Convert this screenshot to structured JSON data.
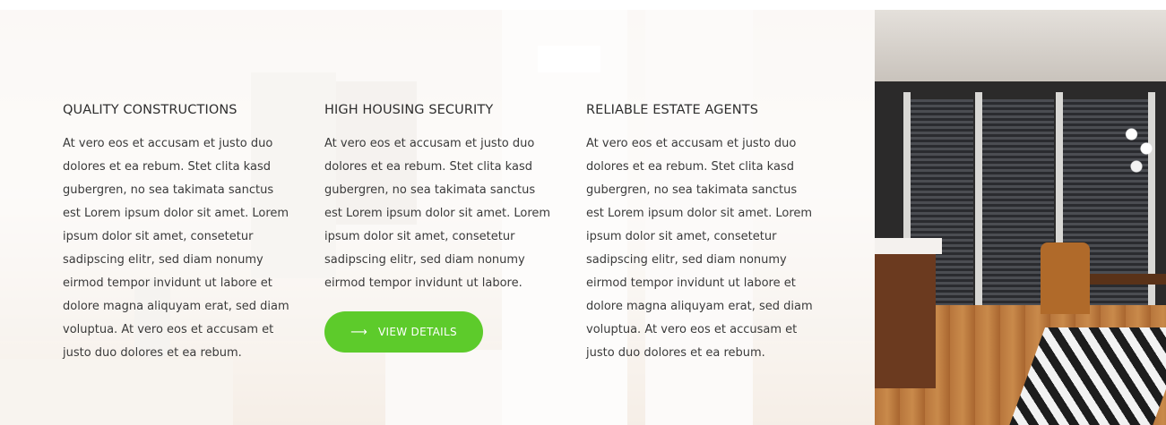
{
  "features": [
    {
      "title": "QUALITY CONSTRUCTIONS",
      "text": "At vero eos et accusam et justo duo dolores et ea rebum. Stet clita kasd gubergren, no sea takimata sanctus est Lorem ipsum dolor sit amet. Lorem ipsum dolor sit amet, consetetur sadipscing elitr, sed diam nonumy eirmod tempor invidunt ut labore et dolore magna aliquyam erat, sed diam voluptua. At vero eos et accusam et justo duo dolores et ea rebum."
    },
    {
      "title": "HIGH HOUSING SECURITY",
      "text": "At vero eos et accusam et justo duo dolores et ea rebum. Stet clita kasd gubergren, no sea takimata sanctus est Lorem ipsum dolor sit amet. Lorem ipsum dolor sit amet, consetetur sadipscing elitr, sed diam nonumy eirmod tempor invidunt ut labore.",
      "button_label": "VIEW DETAILS",
      "button_icon": "arrow-right-icon"
    },
    {
      "title": "RELIABLE ESTATE AGENTS",
      "text": "At vero eos et accusam et justo duo dolores et ea rebum. Stet clita kasd gubergren, no sea takimata sanctus est Lorem ipsum dolor sit amet. Lorem ipsum dolor sit amet, consetetur sadipscing elitr, sed diam nonumy eirmod tempor invidunt ut labore et dolore magna aliquyam erat, sed diam voluptua. At vero eos et accusam et justo duo dolores et ea rebum."
    }
  ],
  "colors": {
    "accent": "#5dcb2b",
    "heading": "#2e2e2e",
    "body_text": "#3a3a3a"
  }
}
